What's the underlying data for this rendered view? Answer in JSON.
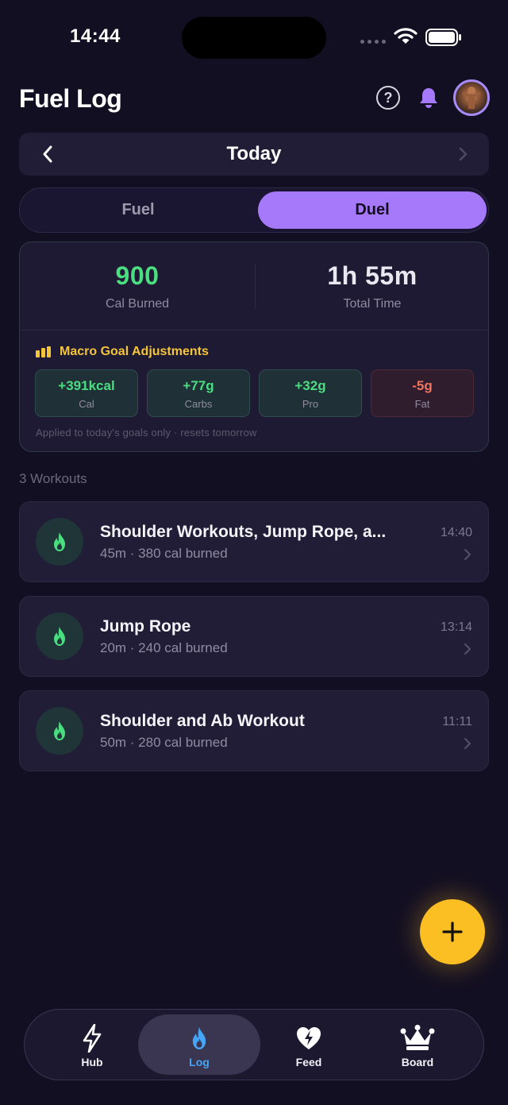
{
  "status_bar": {
    "time": "14:44"
  },
  "header": {
    "title": "Fuel Log",
    "help_label": "?"
  },
  "date_nav": {
    "label": "Today"
  },
  "segmented": {
    "options": [
      "Fuel",
      "Duel"
    ],
    "selected": "Duel"
  },
  "summary": {
    "burned_value": "900",
    "burned_label": "Cal Burned",
    "time_value": "1h 55m",
    "time_label": "Total Time"
  },
  "macro": {
    "title": "Macro Goal Adjustments",
    "chips": [
      {
        "value": "+391kcal",
        "label": "Cal"
      },
      {
        "value": "+77g",
        "label": "Carbs"
      },
      {
        "value": "+32g",
        "label": "Pro"
      },
      {
        "value": "-5g",
        "label": "Fat"
      }
    ],
    "note": "Applied to today's goals only · resets tomorrow"
  },
  "workouts_section": {
    "title": "3 Workouts"
  },
  "workouts": [
    {
      "title": "Shoulder Workouts, Jump Rope, a...",
      "subtitle": "45m · 380 cal burned",
      "time": "14:40"
    },
    {
      "title": "Jump Rope",
      "subtitle": "20m · 240 cal burned",
      "time": "13:14"
    },
    {
      "title": "Shoulder and Ab Workout",
      "subtitle": "50m · 280 cal burned",
      "time": "11:11"
    }
  ],
  "tabs": [
    {
      "label": "Hub",
      "icon": "bolt-icon"
    },
    {
      "label": "Log",
      "icon": "flame-icon"
    },
    {
      "label": "Feed",
      "icon": "heart-bolt-icon"
    },
    {
      "label": "Board",
      "icon": "crown-icon"
    }
  ],
  "active_tab": "Log",
  "colors": {
    "background": "#130f22",
    "accent_purple": "#a678fa",
    "positive_green": "#4ade80",
    "negative_red": "#f0745f",
    "gold": "#fbbf24",
    "active_tab_blue": "#46a6f5"
  }
}
